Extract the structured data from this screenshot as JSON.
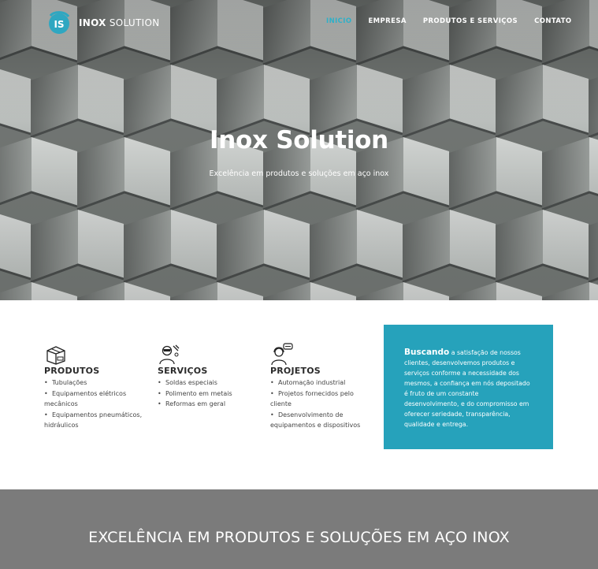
{
  "header": {
    "logo_bold": "INOX",
    "logo_rest": " SOLUTION",
    "logo_mark_text": "IS",
    "nav": [
      {
        "label": "INICIO",
        "active": true
      },
      {
        "label": "EMPRESA",
        "active": false
      },
      {
        "label": "PRODUTOS E SERVIÇOS",
        "active": false
      },
      {
        "label": "CONTATO",
        "active": false
      }
    ]
  },
  "hero": {
    "title": "Inox Solution",
    "subtitle": "Excelência em produtos e soluções em aço inox"
  },
  "features": [
    {
      "icon": "box-icon",
      "title": "PRODUTOS",
      "items": [
        "Tubulações",
        "Equipamentos elétricos mecânicos",
        "Equipamentos pneumáticos, hidráulicos"
      ]
    },
    {
      "icon": "welder-icon",
      "title": "SERVIÇOS",
      "items": [
        "Soldas especiais",
        "Polimento em metais",
        "Reformas em geral"
      ]
    },
    {
      "icon": "support-agent-icon",
      "title": "PROJETOS",
      "items": [
        "Automação industrial",
        "Projetos fornecidos pelo cliente",
        "Desenvolvimento de equipamentos e dispositivos"
      ]
    }
  ],
  "about": {
    "lead": "Buscando",
    "text": " a satisfação de nossos clientes, desenvolvemos produtos e serviços conforme a necessidade dos mesmos, a confiança em nós depositado é fruto de um constante desenvolvimento, e do compromisso em oferecer seriedade, transparência, qualidade e entrega."
  },
  "banner": {
    "title": "EXCELÊNCIA EM PRODUTOS E SOLUÇÕES EM AÇO INOX"
  },
  "colors": {
    "accent": "#26a2bb",
    "nav_active": "#2fb0c8",
    "banner": "#7b7b7b"
  }
}
